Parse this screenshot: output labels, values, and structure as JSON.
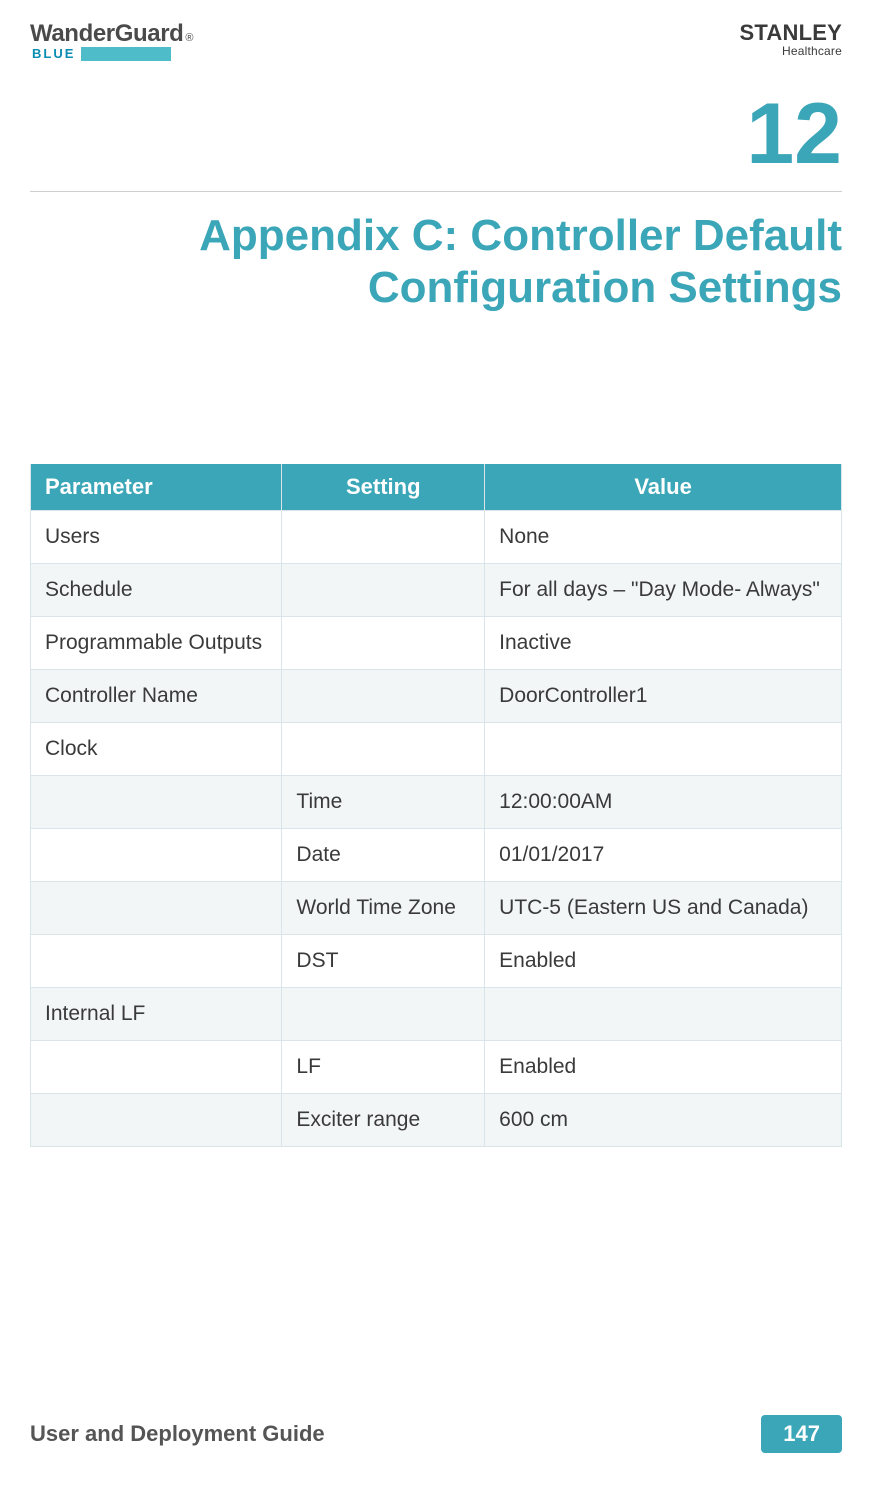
{
  "header": {
    "left_logo_main": "WanderGuard",
    "left_logo_reg": "®",
    "left_logo_sub": "BLUE",
    "right_logo_main": "STANLEY",
    "right_logo_sub": "Healthcare"
  },
  "chapter_number": "12",
  "title_line1": "Appendix C: Controller Default",
  "title_line2": "Configuration Settings",
  "table": {
    "head": {
      "parameter": "Parameter",
      "setting": "Setting",
      "value": "Value"
    },
    "rows": [
      {
        "parameter": "Users",
        "setting": "",
        "value": "None"
      },
      {
        "parameter": "Schedule",
        "setting": "",
        "value": "For all days – \"Day Mode- Always\""
      },
      {
        "parameter": "Programmable Outputs",
        "setting": "",
        "value": "Inactive"
      },
      {
        "parameter": "Controller Name",
        "setting": "",
        "value": "DoorController1"
      },
      {
        "parameter": "Clock",
        "setting": "",
        "value": ""
      },
      {
        "parameter": "",
        "setting": "Time",
        "value": "12:00:00AM"
      },
      {
        "parameter": "",
        "setting": "Date",
        "value": "01/01/2017"
      },
      {
        "parameter": "",
        "setting": "World Time Zone",
        "value": "UTC-5 (Eastern US and Canada)"
      },
      {
        "parameter": "",
        "setting": "DST",
        "value": "Enabled"
      },
      {
        "parameter": "Internal LF",
        "setting": "",
        "value": ""
      },
      {
        "parameter": "",
        "setting": "LF",
        "value": "Enabled"
      },
      {
        "parameter": "",
        "setting": "Exciter range",
        "value": "600 cm"
      }
    ]
  },
  "footer": {
    "doc_title": "User and Deployment Guide",
    "page_no": "147"
  }
}
